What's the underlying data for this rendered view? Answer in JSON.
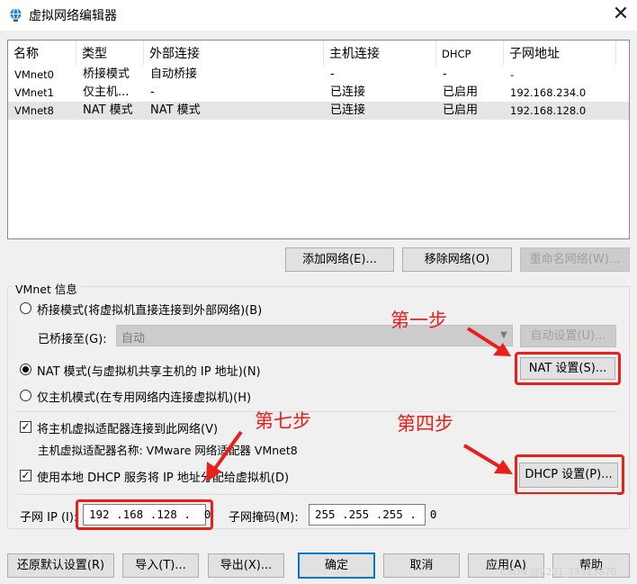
{
  "window": {
    "title": "虚拟网络编辑器",
    "icon": "globe-network-icon",
    "close_glyph": "✕"
  },
  "list": {
    "headers": [
      "名称",
      "类型",
      "外部连接",
      "主机连接",
      "DHCP",
      "子网地址"
    ],
    "rows": [
      [
        "VMnet0",
        "桥接模式",
        "自动桥接",
        "-",
        "-",
        "-"
      ],
      [
        "VMnet1",
        "仅主机...",
        "-",
        "已连接",
        "已启用",
        "192.168.234.0"
      ],
      [
        "VMnet8",
        "NAT 模式",
        "NAT 模式",
        "已连接",
        "已启用",
        "192.168.128.0"
      ]
    ],
    "selected_row": 2
  },
  "list_buttons": {
    "add": "添加网络(E)...",
    "remove": "移除网络(O)",
    "rename": "重命名网络(W)..."
  },
  "vmnet_info": {
    "label": "VMnet 信息",
    "bridge_radio": "桥接模式(将虚拟机直接连接到外部网络)(B)",
    "bridged_to_label": "已桥接至(G):",
    "bridged_to_value": "自动",
    "auto_settings": "自动设置(U)...",
    "nat_radio": "NAT 模式(与虚拟机共享主机的 IP 地址)(N)",
    "nat_settings": "NAT 设置(S)...",
    "hostonly_radio": "仅主机模式(在专用网络内连接虚拟机)(H)",
    "selected_mode": "nat",
    "connect_adapter_check": "将主机虚拟适配器连接到此网络(V)",
    "adapter_name_label": "主机虚拟适配器名称: VMware 网络适配器 VMnet8",
    "dhcp_check": "使用本地 DHCP 服务将 IP 地址分配给虚拟机(D)",
    "dhcp_settings": "DHCP 设置(P)...",
    "subnet_ip_label": "子网 IP (I):",
    "subnet_ip_value": "192 .168 .128 .  0",
    "subnet_mask_label": "子网掩码(M):",
    "subnet_mask_value": "255 .255 .255 .  0"
  },
  "bottom_buttons": {
    "restore": "还原默认设置(R)",
    "import": "导入(T)...",
    "export": "导出(X)...",
    "ok": "确定",
    "cancel": "取消",
    "apply": "应用(A)",
    "help": "帮助"
  },
  "annotations": {
    "step1": "第一步",
    "step4": "第四步",
    "step7": "第七步",
    "color": "#e8201c"
  },
  "watermark": "CSDN @2201_75523870"
}
